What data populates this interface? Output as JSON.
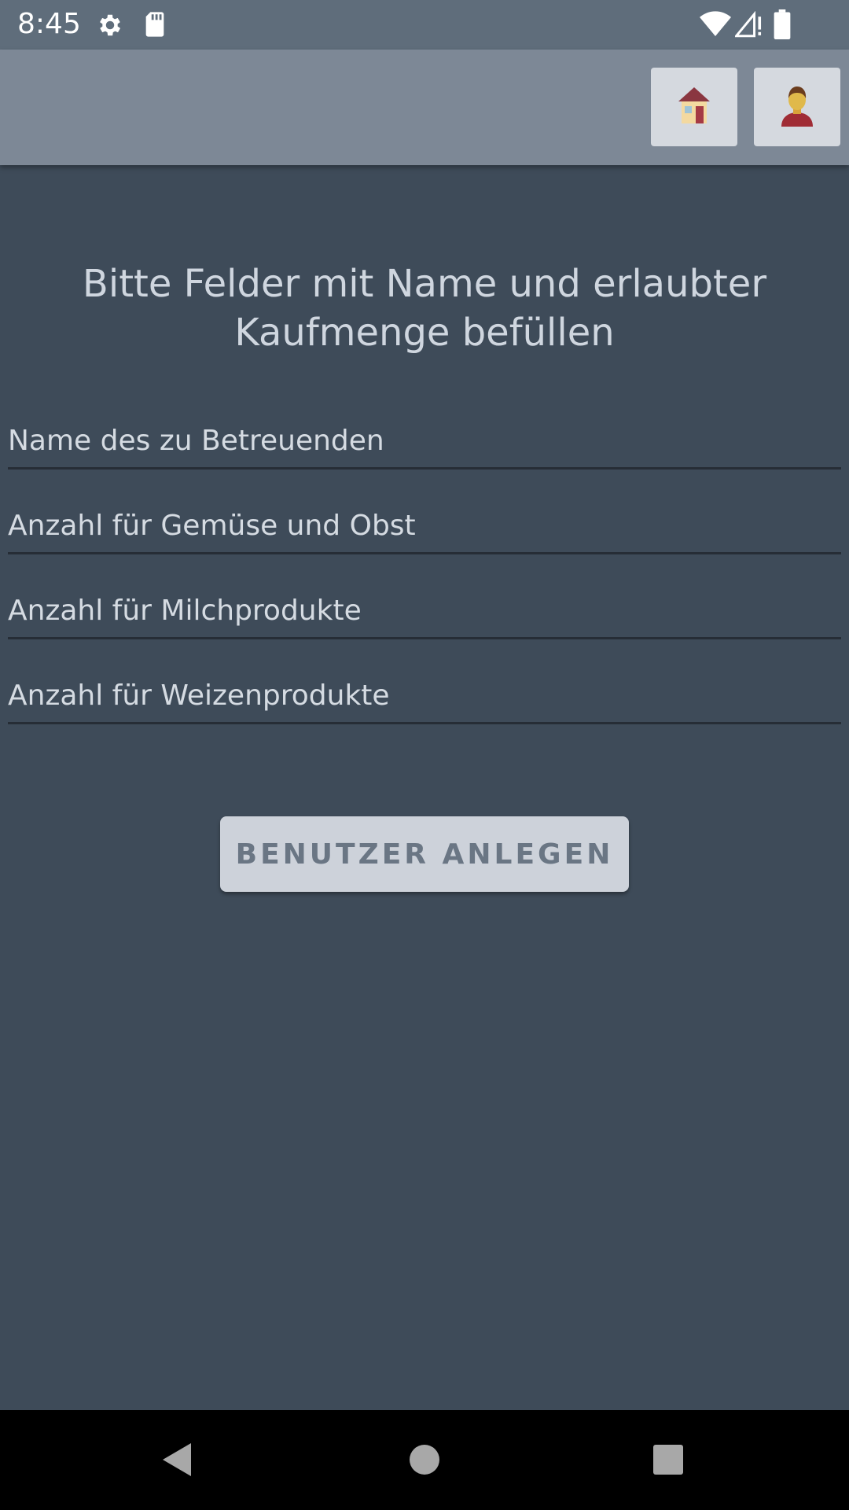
{
  "status_bar": {
    "time": "8:45",
    "icons": [
      "settings-icon",
      "sd-card-icon",
      "wifi-icon",
      "cell-signal-icon",
      "battery-icon"
    ]
  },
  "app_bar": {
    "buttons": [
      {
        "icon": "home-icon"
      },
      {
        "icon": "user-avatar-icon"
      }
    ]
  },
  "form": {
    "title": "Bitte Felder mit Name und erlaubter Kaufmenge befüllen",
    "fields": [
      {
        "placeholder": "Name des zu Betreuenden",
        "value": ""
      },
      {
        "placeholder": "Anzahl für Gemüse und Obst",
        "value": ""
      },
      {
        "placeholder": "Anzahl für Milchprodukte",
        "value": ""
      },
      {
        "placeholder": "Anzahl für Weizenprodukte",
        "value": ""
      }
    ],
    "submit_label": "BENUTZER ANLEGEN"
  },
  "nav_bar": {
    "icons": [
      "back-icon",
      "home-circle-icon",
      "recents-icon"
    ]
  },
  "colors": {
    "background": "#3e4b59",
    "status_bar": "#5f6d7b",
    "app_bar": "#7d8896",
    "button": "#cdd2da",
    "button_text": "#6a7684",
    "text": "#cfd6df"
  }
}
